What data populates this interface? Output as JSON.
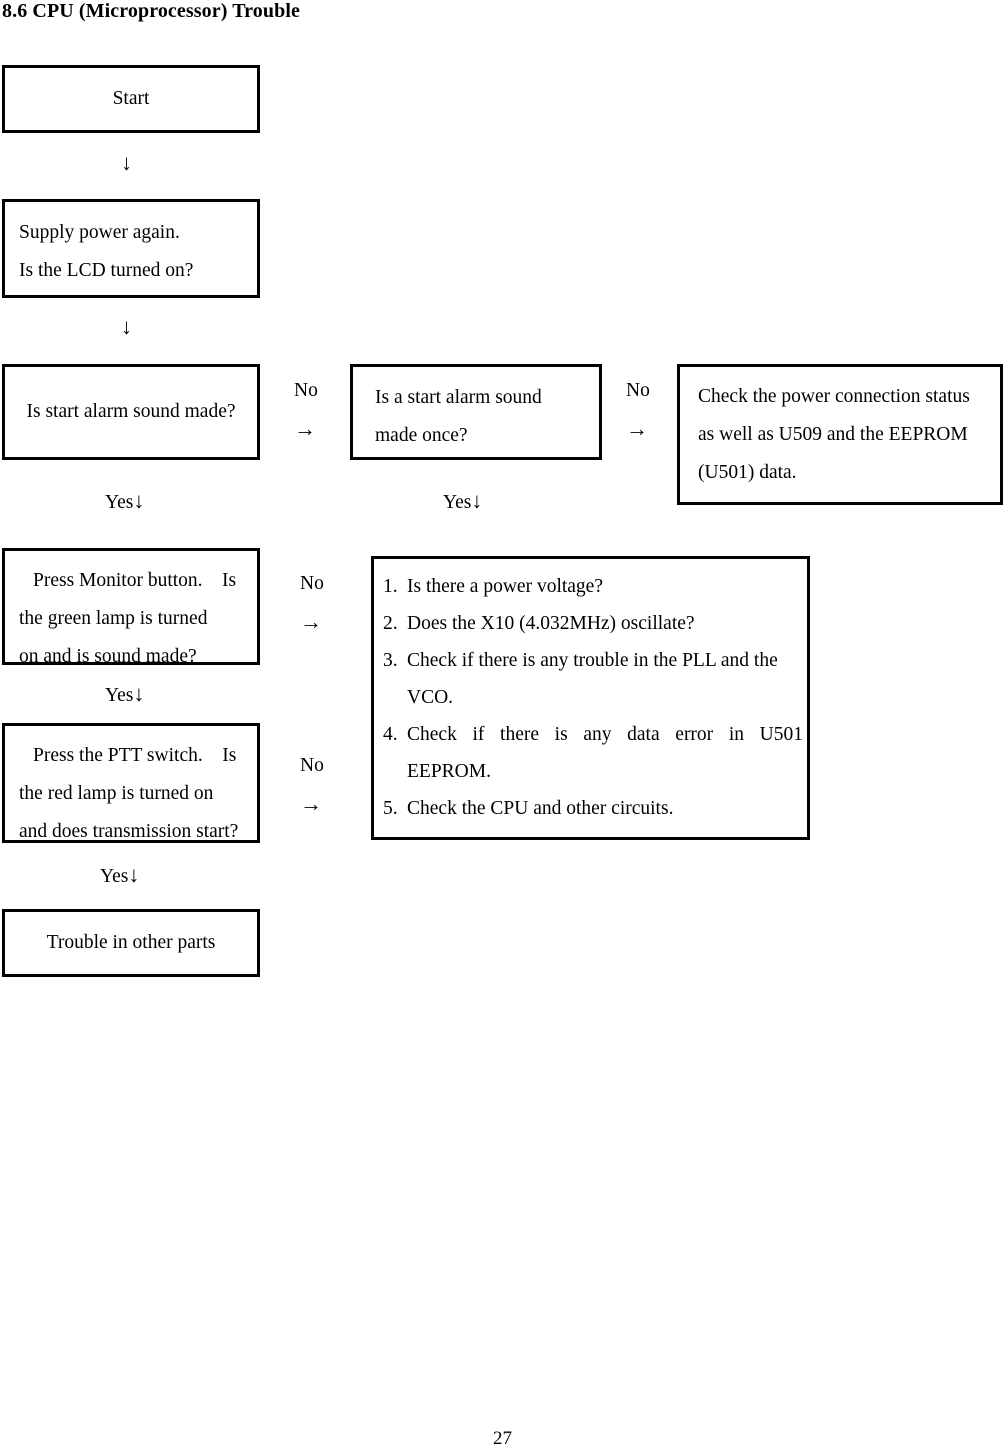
{
  "document": {
    "title": "8.6 CPU (Microprocessor) Trouble",
    "page_number": "27"
  },
  "flowchart": {
    "start_box": {
      "text": "Start"
    },
    "power_box": {
      "line1": "Supply power again.",
      "line2": "Is the LCD turned on?"
    },
    "alarm_box": {
      "text": "Is start alarm sound made?"
    },
    "alarm_once_box": {
      "line1": "Is a start alarm sound",
      "line2": "made once?"
    },
    "power_connection_box": {
      "line1": "Check the power connection status",
      "line2": "as well as U509 and the EEPROM",
      "line3": "(U501) data."
    },
    "monitor_box": {
      "line1": "Press Monitor button. Is",
      "line2": "the green lamp is turned",
      "line3": "on and is sound made?"
    },
    "ptt_box": {
      "line1": "Press the PTT switch. Is",
      "line2": "the red lamp is turned on",
      "line3": "and does transmission start?"
    },
    "other_parts_box": {
      "text": "Trouble in other parts"
    },
    "check_list_box": {
      "items": [
        {
          "num": "1.",
          "text": "Is there a power voltage?"
        },
        {
          "num": "2.",
          "text": "Does the X10 (4.032MHz) oscillate?"
        },
        {
          "num": "3.",
          "text": "Check if there is any trouble in the PLL and the VCO."
        },
        {
          "num": "4.",
          "text": "Check if there is any data error in U501 EEPROM."
        },
        {
          "num": "5.",
          "text": "Check the CPU and other circuits."
        }
      ]
    },
    "connectors": {
      "arrow_down_1": "↓",
      "arrow_down_2": "↓",
      "no_1": {
        "label": "No",
        "arrow": "→"
      },
      "no_2": {
        "label": "No",
        "arrow": "→"
      },
      "no_3": {
        "label": "No",
        "arrow": "→"
      },
      "no_4": {
        "label": "No",
        "arrow": "→"
      },
      "yes_1": {
        "label": "Yes",
        "arrow": "↓"
      },
      "yes_2": {
        "label": "Yes",
        "arrow": "↓"
      },
      "yes_3": {
        "label": "Yes",
        "arrow": "↓"
      },
      "yes_4": {
        "label": "Yes",
        "arrow": "↓"
      }
    }
  },
  "colors": {
    "ink": "#000000",
    "paper": "#ffffff"
  }
}
